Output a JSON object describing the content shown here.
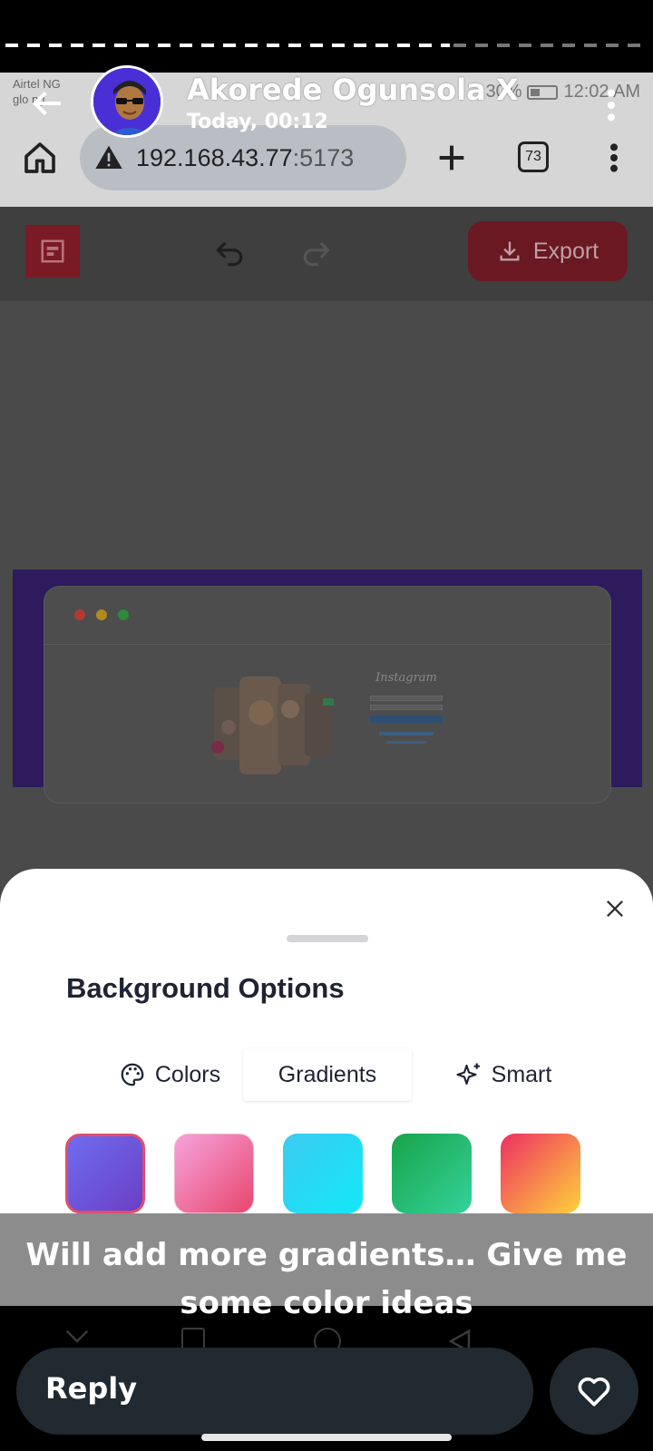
{
  "status_header": {
    "contact_name": "Akorede Ogunsola X",
    "post_time": "Today, 00:12",
    "back_icon": "arrow-left-icon",
    "more_icon": "more-vert-icon"
  },
  "phone_status": {
    "carrier_line1": "Airtel NG",
    "carrier_line2": "glo ng",
    "battery": "30%",
    "time": "12:02 AM"
  },
  "browser": {
    "url_host": "192.168.43.77",
    "url_port": ":5173",
    "tab_count": "73",
    "security_icon": "warning-icon"
  },
  "app_toolbar": {
    "export_label": "Export",
    "undo_icon": "undo-icon",
    "redo_icon": "redo-icon"
  },
  "preview": {
    "instagram_label": "Instagram",
    "traffic_lights": [
      "#b03a33",
      "#b08a1e",
      "#2f8a3a"
    ]
  },
  "sheet": {
    "title": "Background Options",
    "tabs": [
      {
        "label": "Colors",
        "icon": "palette-icon"
      },
      {
        "label": "Gradients",
        "icon": ""
      },
      {
        "label": "Smart",
        "icon": "sparkle-icon"
      }
    ],
    "active_tab": "Gradients",
    "swatches": [
      {
        "from": "#6f6cf0",
        "to": "#6a3fc4",
        "selected": true
      },
      {
        "from": "#f6a3dc",
        "to": "#e8466d",
        "selected": false
      },
      {
        "from": "#3ccaf0",
        "to": "#12e9f8",
        "selected": false
      },
      {
        "from": "#17a34a",
        "to": "#34d39a",
        "selected": false
      },
      {
        "from": "#ee2f63",
        "to": "#ffd23a",
        "selected": false
      }
    ]
  },
  "caption": {
    "line1": "Will add more gradients… Give me",
    "line2": "some color ideas"
  },
  "reply": {
    "label": "Reply",
    "heart_icon": "heart-icon"
  }
}
